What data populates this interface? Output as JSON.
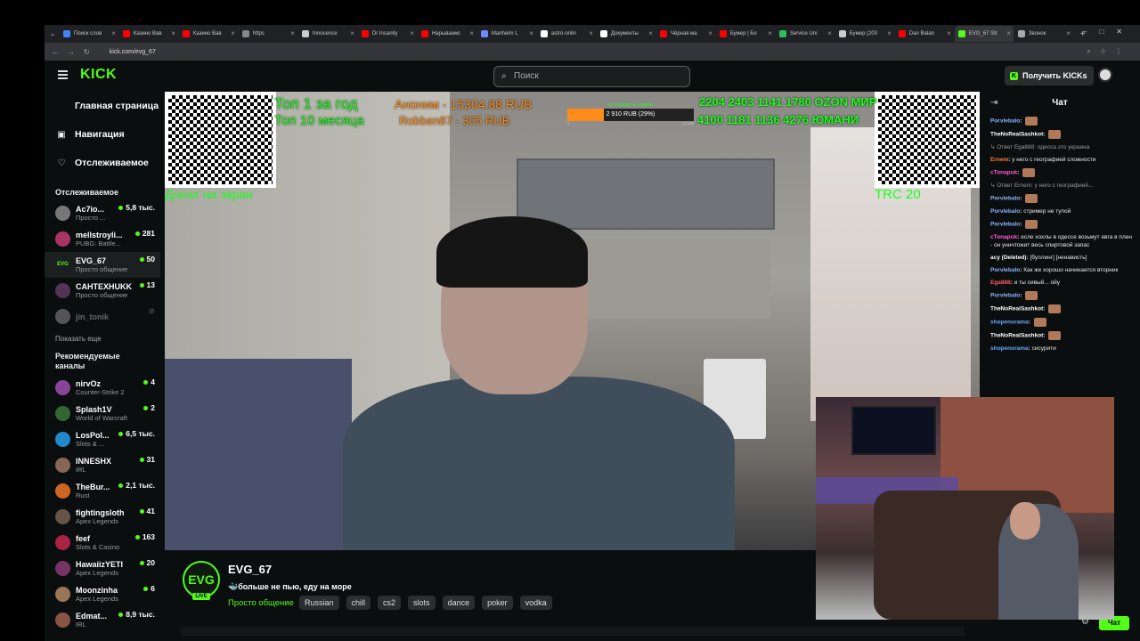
{
  "browser": {
    "tabs": [
      {
        "label": "Поиск слов",
        "color": "#4285f4"
      },
      {
        "label": "Казино Вав",
        "color": "#ff0000"
      },
      {
        "label": "Казино Вав",
        "color": "#ff0000"
      },
      {
        "label": "https",
        "color": "#888888"
      },
      {
        "label": "Innocence",
        "color": "#cccccc"
      },
      {
        "label": "Dr Insanity",
        "color": "#ff0000"
      },
      {
        "label": "Нарываемс",
        "color": "#ff0000"
      },
      {
        "label": "Manheim L",
        "color": "#6b8cff"
      },
      {
        "label": "astro-onlin",
        "color": "#ffffff"
      },
      {
        "label": "Документы",
        "color": "#ffffff"
      },
      {
        "label": "Чёрная ма",
        "color": "#ff0000"
      },
      {
        "label": "Бумер | Бо",
        "color": "#ff0000"
      },
      {
        "label": "Service Uni",
        "color": "#2dbf5a"
      },
      {
        "label": "Бумер (200",
        "color": "#cccccc"
      },
      {
        "label": "Dan Balan",
        "color": "#ff0000"
      },
      {
        "label": "EVG_67 Str",
        "color": "#53fc18"
      },
      {
        "label": "Звонок",
        "color": "#aaaaaa"
      }
    ],
    "url": "kick.com/evg_67"
  },
  "header": {
    "logo": "KICK",
    "search_placeholder": "Поиск",
    "get_kicks": "Получить KICKs"
  },
  "sidebar": {
    "nav": [
      {
        "label": "Главная страница",
        "icon": "home-icon"
      },
      {
        "label": "Навигация",
        "icon": "compass-icon"
      },
      {
        "label": "Отслеживаемое",
        "icon": "heart-icon"
      }
    ],
    "followed_title": "Отслеживаемое",
    "followed": [
      {
        "name": "Ac7io...",
        "category": "Просто ...",
        "viewers": "5,8 тыс.",
        "color": "#777777"
      },
      {
        "name": "mellstroyli...",
        "category": "PUBG: Battle...",
        "viewers": "281",
        "color": "#aa3366"
      },
      {
        "name": "EVG_67",
        "category": "Просто общение",
        "viewers": "50",
        "color": "#1a331a"
      },
      {
        "name": "CAHTEXHUKK",
        "category": "Просто общение",
        "viewers": "13",
        "color": "#553355"
      },
      {
        "name": "jin_tonik",
        "category": "",
        "viewers": "",
        "color": "#555555"
      }
    ],
    "show_more": "Показать еще",
    "recommended_title": "Рекомендуемые каналы",
    "recommended": [
      {
        "name": "nirvOz",
        "category": "Counter-Strike 2",
        "viewers": "4",
        "color": "#884499"
      },
      {
        "name": "Splash1V",
        "category": "World of Warcraft",
        "viewers": "2",
        "color": "#336633"
      },
      {
        "name": "LosPol...",
        "category": "Slots & ...",
        "viewers": "6,5 тыс.",
        "color": "#2288cc"
      },
      {
        "name": "INNESHX",
        "category": "IRL",
        "viewers": "31",
        "color": "#886655"
      },
      {
        "name": "TheBur...",
        "category": "Rust",
        "viewers": "2,1 тыс.",
        "color": "#cc6622"
      },
      {
        "name": "fightingsloth",
        "category": "Apex Legends",
        "viewers": "41",
        "color": "#665544"
      },
      {
        "name": "feef",
        "category": "Slots & Casino",
        "viewers": "163",
        "color": "#aa2244"
      },
      {
        "name": "HawaiizYETI",
        "category": "Apex Legends",
        "viewers": "20",
        "color": "#773366"
      },
      {
        "name": "Moonzinha",
        "category": "Apex Legends",
        "viewers": "6",
        "color": "#997755"
      },
      {
        "name": "Edmat...",
        "category": "IRL",
        "viewers": "8,9 тыс.",
        "color": "#885544"
      }
    ]
  },
  "overlay": {
    "top_year": "Топ 1 за год",
    "top_month": "Топ 10 месяца",
    "anon": "Аноним - 15304.88 RUB",
    "robben": "Robben87 - 305 RUB",
    "goal_title": "на поездку на неделю",
    "goal_label": "2 910 RUB (29%)",
    "goal_start": "0",
    "goal_end": "10 000",
    "goal_progress": 0.29,
    "card1": "2204 2403 1141 1780 OZON МИР",
    "card2": "4100 1181 1136 4276 ЮМАНИ",
    "donat": "Донат на экран",
    "trc": "TRC 20"
  },
  "stream": {
    "channel": "EVG_67",
    "avatar_text": "EVG",
    "live": "LIVE",
    "title": "🐳больше не пью, еду на море",
    "category": "Просто общение",
    "tags": [
      "Russian",
      "chill",
      "cs2",
      "slots",
      "dance",
      "poker",
      "vodka"
    ]
  },
  "chat": {
    "title": "Чат",
    "button": "Чат",
    "messages": [
      {
        "user": "Porvlebalo",
        "text": "",
        "color": "#8ab4ff",
        "emote": true
      },
      {
        "user": "TheNoRealSashkot",
        "text": "",
        "color": "#ffffff",
        "emote": true
      },
      {
        "user": "",
        "text": "↳ Ответ Ega888: одесса это украина",
        "color": "#9a9a9a",
        "emote": false
      },
      {
        "user": "Ernem",
        "text": "у него с географией сложности",
        "color": "#ff7a33",
        "emote": false
      },
      {
        "user": "cTonapuk",
        "text": "",
        "color": "#ff5ad2",
        "emote": true
      },
      {
        "user": "",
        "text": "↳ Ответ Ernem: у него с географией...",
        "color": "#9a9a9a",
        "emote": false
      },
      {
        "user": "Porvlebalo",
        "text": "",
        "color": "#8ab4ff",
        "emote": true
      },
      {
        "user": "Porvlebalo",
        "text": "стример не тупой",
        "color": "#8ab4ff",
        "emote": false
      },
      {
        "user": "Porvlebalo",
        "text": "",
        "color": "#8ab4ff",
        "emote": true
      },
      {
        "user": "cTonapuk",
        "text": "есле хохлы в одессе возьмут евга в плен - он уничтожит весь спиртовой запас",
        "color": "#ff5ad2",
        "emote": false
      },
      {
        "user": "acy (Deleted)",
        "text": "[буллинг] [ненависть]",
        "color": "#ffffff",
        "emote": false
      },
      {
        "user": "Porvlebalo",
        "text": "Как же хорошо начинается вторник",
        "color": "#8ab4ff",
        "emote": false
      },
      {
        "user": "Ega888",
        "text": "и ты сивый... ойу",
        "color": "#ff5a5a",
        "emote": false
      },
      {
        "user": "Porvlebalo",
        "text": "",
        "color": "#8ab4ff",
        "emote": true
      },
      {
        "user": "TheNoRealSashkot",
        "text": "",
        "color": "#ffffff",
        "emote": true
      },
      {
        "user": "shopenorama",
        "text": "",
        "color": "#6aa8ff",
        "emote": true
      },
      {
        "user": "TheNoRealSashkot",
        "text": "",
        "color": "#ffffff",
        "emote": true
      },
      {
        "user": "shopenorama",
        "text": "сисурити",
        "color": "#6aa8ff",
        "emote": false
      }
    ]
  },
  "colors": {
    "accent": "#53fc18",
    "background": "#0b0e0f"
  }
}
